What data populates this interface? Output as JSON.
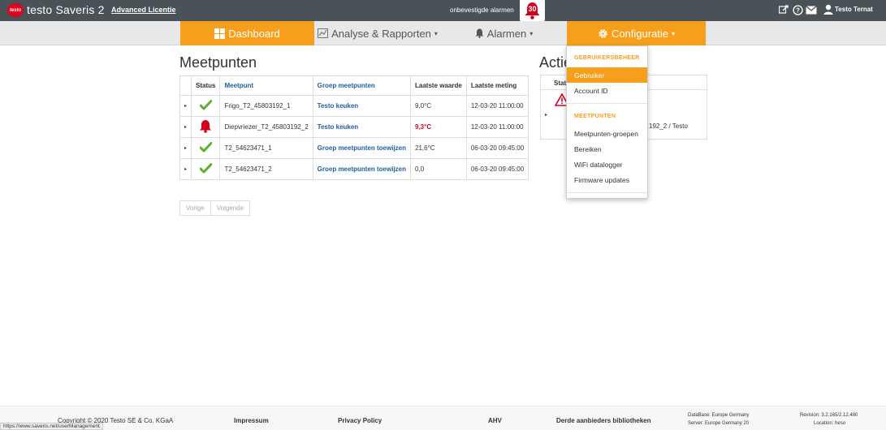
{
  "header": {
    "logo_text": "testo",
    "app_title": "testo Saveris 2",
    "license_label": "Advanced Licentie",
    "unacknowledged_label": "onbevestigde alarmen",
    "alarm_count": "30",
    "user_name": "Testo Ternat",
    "icons": [
      "tools-icon",
      "help-icon",
      "mail-icon",
      "user-icon"
    ]
  },
  "nav": {
    "dashboard": "Dashboard",
    "analysis": "Analyse & Rapporten",
    "alarms": "Alarmen",
    "configuration": "Configuratie"
  },
  "measuring_points": {
    "title": "Meetpunten",
    "columns": [
      "Status",
      "Meetpunt",
      "Groep meetpunten",
      "Laatste waarde",
      "Laatste meting"
    ],
    "rows": [
      {
        "status": "ok",
        "name": "Frigo_T2_45803192_1",
        "group": "Testo keuken",
        "value": "9,0°C",
        "time": "12-03-20 11:00:00"
      },
      {
        "status": "alarm",
        "name": "Diepvriezer_T2_45803192_2",
        "group": "Testo keuken",
        "value": "9,3°C",
        "time": "12-03-20 11:00:00"
      },
      {
        "status": "ok",
        "name": "T2_54623471_1",
        "group": "Groep meetpunten toewijzen",
        "value": "21,6°C",
        "time": "06-03-20 09:45:00"
      },
      {
        "status": "ok",
        "name": "T2_54623471_2",
        "group": "Groep meetpunten toewijzen",
        "value": "0,0",
        "time": "06-03-20 09:45:00"
      }
    ],
    "prev": "Vorige",
    "next": "Volgende"
  },
  "actions": {
    "title": "Actie",
    "header": "Stat",
    "row_text": "192_2 / Testo"
  },
  "dropdown": {
    "section1": "GEBRUIKERSBEHEER",
    "user": "Gebruiker",
    "account": "Account ID",
    "section2": "MEETPUNTEN",
    "groups": "Meetpunten-groepen",
    "ranges": "Bereiken",
    "wifi": "WiFi datalogger",
    "firmware": "Firmware updates"
  },
  "footer": {
    "copyright": "Copyright © 2020 Testo SE & Co. KGaA",
    "impressum": "Impressum",
    "privacy": "Privacy Policy",
    "ahv": "AHV",
    "third_party": "Derde aanbieders bibliotheken",
    "database": "DataBase: Europe Germany",
    "server": "Server: Europe Germany 20",
    "revision": "Revision: 3.2.165/2.12.480",
    "location": "Location: heso"
  },
  "status_url": "https://www.saveris.net/userManagement",
  "colors": {
    "accent": "#f79f1a",
    "topbar": "#4a5257",
    "alarm": "#d0021b",
    "ok": "#5bb12f",
    "link": "#1f5f9e"
  }
}
